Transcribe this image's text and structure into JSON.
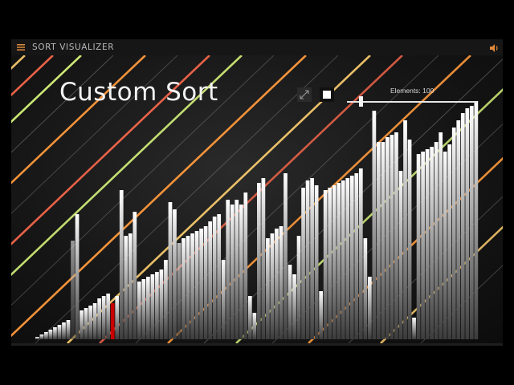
{
  "app": {
    "title": "SORT VISUALIZER",
    "menu_icon": "hamburger-menu-icon",
    "sound_icon": "speaker-icon"
  },
  "visualizer": {
    "algorithm_title": "Custom Sort",
    "elements_label": "Elements: 100",
    "element_count": 100,
    "slider_fraction": 0.09,
    "expand_icon": "expand-arrows-icon",
    "stop_icon": "stop-square-icon",
    "highlight_index": 17,
    "highlight_color": "#c80000",
    "bar_color_top": "#ffffff",
    "bar_color_bottom": "#3c3c3c",
    "accent_colors": [
      "#ff9a3c",
      "#ff6a4c",
      "#e0ff80",
      "#ffd070"
    ],
    "bar_heights": [
      0.01,
      0.02,
      0.03,
      0.04,
      0.05,
      0.06,
      0.07,
      0.08,
      0.41,
      0.52,
      0.12,
      0.13,
      0.14,
      0.15,
      0.17,
      0.18,
      0.19,
      0.15,
      0.18,
      0.62,
      0.43,
      0.44,
      0.53,
      0.24,
      0.25,
      0.26,
      0.27,
      0.28,
      0.29,
      0.33,
      0.57,
      0.54,
      0.4,
      0.42,
      0.43,
      0.44,
      0.45,
      0.46,
      0.47,
      0.49,
      0.51,
      0.52,
      0.33,
      0.58,
      0.56,
      0.58,
      0.56,
      0.61,
      0.18,
      0.11,
      0.65,
      0.67,
      0.42,
      0.44,
      0.46,
      0.47,
      0.69,
      0.31,
      0.27,
      0.43,
      0.63,
      0.66,
      0.67,
      0.64,
      0.2,
      0.62,
      0.63,
      0.64,
      0.65,
      0.66,
      0.67,
      0.68,
      0.69,
      0.71,
      0.42,
      0.26,
      0.95,
      0.82,
      0.82,
      0.84,
      0.85,
      0.86,
      0.7,
      0.91,
      0.83,
      0.09,
      0.77,
      0.78,
      0.79,
      0.8,
      0.82,
      0.86,
      0.78,
      0.81,
      0.88,
      0.91,
      0.94,
      0.96,
      0.97,
      0.99
    ],
    "bar_shades": [
      1,
      1,
      1,
      1,
      1,
      1,
      1,
      1,
      0.55,
      1,
      1,
      1,
      1,
      1,
      1,
      1,
      1,
      1,
      1,
      1,
      1,
      1,
      1,
      1,
      1,
      1,
      1,
      1,
      1,
      1,
      1,
      1,
      0.7,
      1,
      1,
      1,
      1,
      1,
      1,
      1,
      1,
      1,
      1,
      1,
      1,
      1,
      1,
      1,
      1,
      1,
      1,
      1,
      1,
      1,
      1,
      1,
      1,
      1,
      1,
      1,
      1,
      1,
      1,
      1,
      1,
      1,
      1,
      1,
      1,
      1,
      1,
      1,
      1,
      1,
      1,
      1,
      1,
      1,
      1,
      1,
      1,
      1,
      1,
      1,
      1,
      1,
      1,
      1,
      1,
      1,
      1,
      1,
      1,
      1,
      1,
      1,
      1,
      1,
      1,
      1
    ]
  }
}
